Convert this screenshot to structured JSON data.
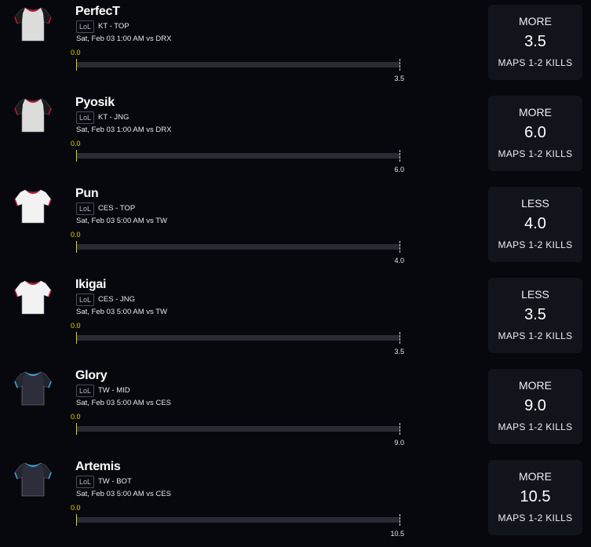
{
  "players": [
    {
      "name": "PerfecT",
      "game": "LoL",
      "team_pos": "KT - TOP",
      "match_time": "Sat, Feb 03 1:00 AM  vs DRX",
      "current": "0.0",
      "progress": 0,
      "target": "3.5",
      "pick": {
        "direction": "MORE",
        "line": "3.5",
        "stat": "MAPS 1-2 KILLS"
      },
      "jersey": {
        "icon": "red-shoulder-jersey-icon",
        "body": "#dcdcdc",
        "sleeve": "#1a1a1a",
        "trim": "#c8102e"
      }
    },
    {
      "name": "Pyosik",
      "game": "LoL",
      "team_pos": "KT - JNG",
      "match_time": "Sat, Feb 03 1:00 AM  vs DRX",
      "current": "0.0",
      "progress": 0,
      "target": "6.0",
      "pick": {
        "direction": "MORE",
        "line": "6.0",
        "stat": "MAPS 1-2 KILLS"
      },
      "jersey": {
        "icon": "red-shoulder-jersey-icon",
        "body": "#dcdcdc",
        "sleeve": "#1a1a1a",
        "trim": "#c8102e"
      }
    },
    {
      "name": "Pun",
      "game": "LoL",
      "team_pos": "CES - TOP",
      "match_time": "Sat, Feb 03 5:00 AM  vs TW",
      "current": "0.0",
      "progress": 0,
      "target": "4.0",
      "pick": {
        "direction": "LESS",
        "line": "4.0",
        "stat": "MAPS 1-2 KILLS"
      },
      "jersey": {
        "icon": "white-jersey-icon",
        "body": "#f2f2f2",
        "sleeve": "#f2f2f2",
        "trim": "#c8102e"
      }
    },
    {
      "name": "Ikigai",
      "game": "LoL",
      "team_pos": "CES - JNG",
      "match_time": "Sat, Feb 03 5:00 AM  vs TW",
      "current": "0.0",
      "progress": 0,
      "target": "3.5",
      "pick": {
        "direction": "LESS",
        "line": "3.5",
        "stat": "MAPS 1-2 KILLS"
      },
      "jersey": {
        "icon": "white-jersey-icon",
        "body": "#f2f2f2",
        "sleeve": "#f2f2f2",
        "trim": "#c8102e"
      }
    },
    {
      "name": "Glory",
      "game": "LoL",
      "team_pos": "TW - MID",
      "match_time": "Sat, Feb 03 5:00 AM  vs CES",
      "current": "0.0",
      "progress": 0,
      "target": "9.0",
      "pick": {
        "direction": "MORE",
        "line": "9.0",
        "stat": "MAPS 1-2 KILLS"
      },
      "jersey": {
        "icon": "dark-blue-jersey-icon",
        "body": "#2c2e3c",
        "sleeve": "#23252f",
        "trim": "#3aa0e0"
      }
    },
    {
      "name": "Artemis",
      "game": "LoL",
      "team_pos": "TW - BOT",
      "match_time": "Sat, Feb 03 5:00 AM  vs CES",
      "current": "0.0",
      "progress": 0,
      "target": "10.5",
      "pick": {
        "direction": "MORE",
        "line": "10.5",
        "stat": "MAPS 1-2 KILLS"
      },
      "jersey": {
        "icon": "dark-blue-jersey-icon",
        "body": "#2c2e3c",
        "sleeve": "#23252f",
        "trim": "#3aa0e0"
      }
    }
  ],
  "colors": {
    "background": "#07080e",
    "card": "#12141c",
    "progress": "#e6d400",
    "track": "#2a2c34"
  }
}
